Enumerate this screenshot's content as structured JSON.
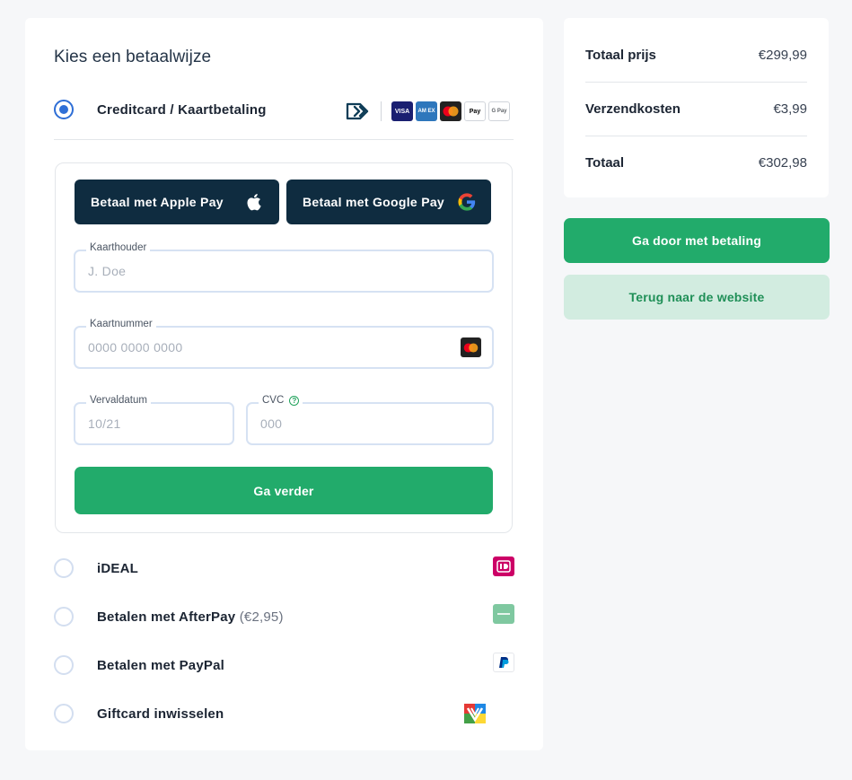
{
  "payment": {
    "title": "Kies een betaalwijze",
    "creditcard_label": "Creditcard / Kaartbetaling",
    "card_logos": [
      {
        "name": "visa",
        "text": "VISA",
        "color": "#1a1f71"
      },
      {
        "name": "amex",
        "text": "AM EX",
        "color": "#2e77bc"
      },
      {
        "name": "mastercard",
        "text": "",
        "color": "#222222"
      },
      {
        "name": "apple-pay",
        "text": "Pay",
        "color": "#ffffff"
      },
      {
        "name": "google-pay",
        "text": "G Pay",
        "color": "#ffffff"
      }
    ],
    "apple_pay_label": "Betaal met Apple Pay",
    "google_pay_label": "Betaal met Google Pay",
    "cardholder": {
      "legend": "Kaarthouder",
      "placeholder": "J. Doe"
    },
    "cardnumber": {
      "legend": "Kaartnummer",
      "placeholder": "0000 0000 0000"
    },
    "expiry": {
      "legend": "Vervaldatum",
      "placeholder": "10/21"
    },
    "cvc": {
      "legend": "CVC",
      "placeholder": "000"
    },
    "continue_label": "Ga verder",
    "methods": {
      "ideal": {
        "label": "iDEAL",
        "logo_color": "#cc0066"
      },
      "afterpay": {
        "label": "Betalen met AfterPay",
        "fee": "(€2,95)",
        "logo_color": "#7fc8a0"
      },
      "paypal": {
        "label": "Betalen met PayPal",
        "logo_color": "#003087"
      },
      "giftcard": {
        "label": "Giftcard inwisselen"
      }
    }
  },
  "summary": {
    "rows": [
      {
        "label": "Totaal prijs",
        "value": "€299,99"
      },
      {
        "label": "Verzendkosten",
        "value": "€3,99"
      },
      {
        "label": "Totaal",
        "value": "€302,98"
      }
    ]
  },
  "actions": {
    "primary_label": "Ga door met betaling",
    "secondary_label": "Terug naar de website"
  },
  "colors": {
    "accent_green": "#22ab6b",
    "dark_button": "#0f2c40",
    "radio_blue": "#2f6fd6"
  }
}
